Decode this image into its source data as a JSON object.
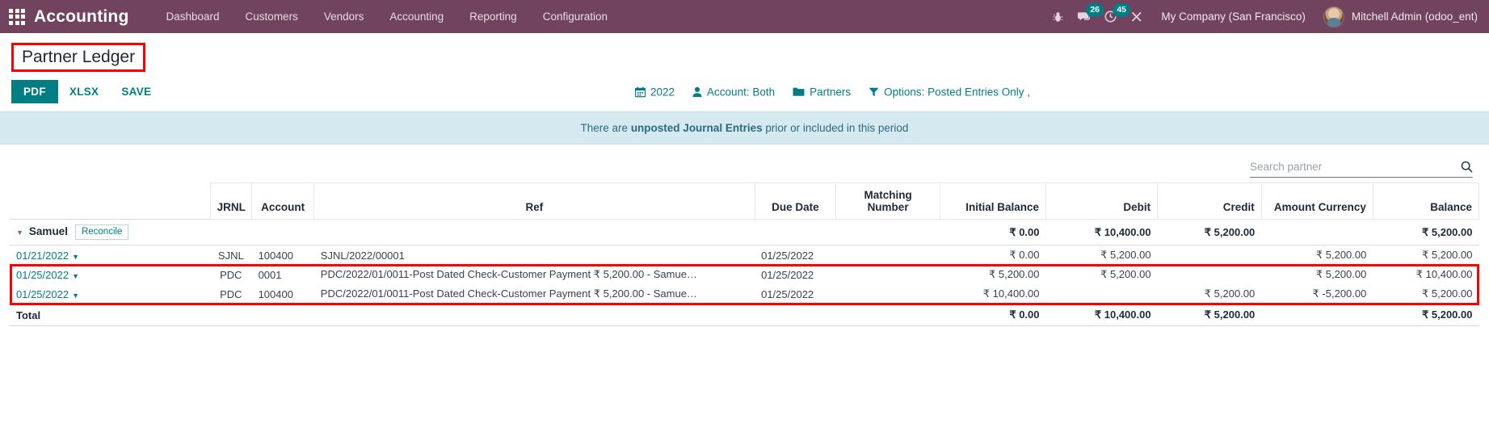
{
  "navbar": {
    "brand": "Accounting",
    "apps_icon": "apps-grid-icon",
    "menu": [
      {
        "label": "Dashboard"
      },
      {
        "label": "Customers"
      },
      {
        "label": "Vendors"
      },
      {
        "label": "Accounting"
      },
      {
        "label": "Reporting"
      },
      {
        "label": "Configuration"
      }
    ],
    "sys_icons": [
      {
        "name": "bug-icon",
        "badge": ""
      },
      {
        "name": "messages-icon",
        "badge": "26"
      },
      {
        "name": "activities-clock-icon",
        "badge": "45"
      },
      {
        "name": "tools-icon",
        "badge": ""
      }
    ],
    "company": "My Company (San Francisco)",
    "user": "Mitchell Admin (odoo_ent)"
  },
  "page": {
    "title": "Partner Ledger"
  },
  "toolbar": {
    "pdf": "PDF",
    "xlsx": "XLSX",
    "save": "SAVE",
    "filters": [
      {
        "icon": "calendar-icon",
        "label": "2022"
      },
      {
        "icon": "user-icon",
        "label": "Account: Both"
      },
      {
        "icon": "folder-icon",
        "label": "Partners"
      },
      {
        "icon": "funnel-icon",
        "label": "Options: Posted Entries Only ,"
      }
    ]
  },
  "alert": {
    "prefix": "There are ",
    "strong": "unposted Journal Entries",
    "suffix": " prior or included in this period"
  },
  "search": {
    "placeholder": "Search partner",
    "value": "",
    "icon": "search-icon"
  },
  "table": {
    "headers": {
      "jrnl": "JRNL",
      "account": "Account",
      "ref": "Ref",
      "due_date": "Due Date",
      "matching_number": "Matching Number",
      "initial_balance": "Initial Balance",
      "debit": "Debit",
      "credit": "Credit",
      "amount_currency": "Amount Currency",
      "balance": "Balance"
    },
    "partner": {
      "name": "Samuel",
      "reconcile_label": "Reconcile",
      "initial_balance": "₹ 0.00",
      "debit": "₹ 10,400.00",
      "credit": "₹ 5,200.00",
      "amount_currency": "",
      "balance": "₹ 5,200.00"
    },
    "rows": [
      {
        "date": "01/21/2022",
        "jrnl": "SJNL",
        "account": "100400",
        "ref": "SJNL/2022/00001",
        "due_date": "01/25/2022",
        "matching_number": "",
        "initial_balance": "₹ 0.00",
        "debit": "₹ 5,200.00",
        "credit": "",
        "amount_currency": "₹ 5,200.00",
        "balance": "₹ 5,200.00",
        "highlighted": false
      },
      {
        "date": "01/25/2022",
        "jrnl": "PDC",
        "account": "0001",
        "ref": "PDC/2022/01/0011-Post Dated Check-Customer Payment ₹ 5,200.00 - Samue…",
        "due_date": "01/25/2022",
        "matching_number": "",
        "initial_balance": "₹ 5,200.00",
        "debit": "₹ 5,200.00",
        "credit": "",
        "amount_currency": "₹ 5,200.00",
        "balance": "₹ 10,400.00",
        "highlighted": true
      },
      {
        "date": "01/25/2022",
        "jrnl": "PDC",
        "account": "100400",
        "ref": "PDC/2022/01/0011-Post Dated Check-Customer Payment ₹ 5,200.00 - Samue…",
        "due_date": "01/25/2022",
        "matching_number": "",
        "initial_balance": "₹ 10,400.00",
        "debit": "",
        "credit": "₹ 5,200.00",
        "amount_currency": "₹ -5,200.00",
        "balance": "₹ 5,200.00",
        "highlighted": true
      }
    ],
    "total": {
      "label": "Total",
      "initial_balance": "₹ 0.00",
      "debit": "₹ 10,400.00",
      "credit": "₹ 5,200.00",
      "amount_currency": "",
      "balance": "₹ 5,200.00"
    }
  },
  "colors": {
    "navbar": "#71435f",
    "accent": "#017e84",
    "alert_bg": "#d4eaf0",
    "highlight": "#ff0000"
  }
}
